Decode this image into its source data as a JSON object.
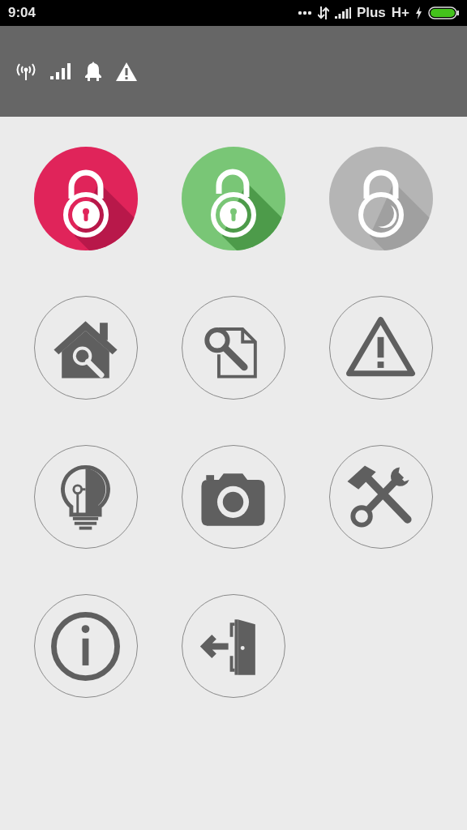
{
  "status_bar": {
    "time": "9:04",
    "carrier": "Plus",
    "network": "H+"
  },
  "tiles": [
    {
      "kind": "lock-closed",
      "color": "#e0245a"
    },
    {
      "kind": "lock-open",
      "color": "#79c676"
    },
    {
      "kind": "lock-neutral",
      "color": "#b5b5b5"
    },
    {
      "kind": "home-search"
    },
    {
      "kind": "document-search"
    },
    {
      "kind": "warning"
    },
    {
      "kind": "bulb"
    },
    {
      "kind": "camera"
    },
    {
      "kind": "tools"
    },
    {
      "kind": "info"
    },
    {
      "kind": "exit"
    }
  ]
}
